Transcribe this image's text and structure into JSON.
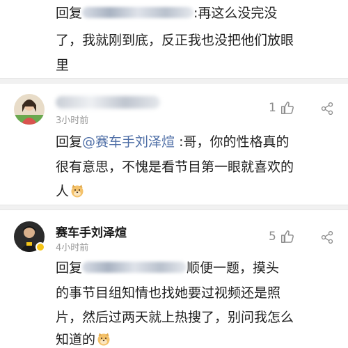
{
  "comment1": {
    "reply_prefix": "回复",
    "reply_text": ":再这么没完没",
    "line2": "了，我就刚到底，反正我也没把他们放眼",
    "line3": "里"
  },
  "comment2": {
    "time": "3小时前",
    "likes": "1",
    "reply_prefix": "回复",
    "mention": "@赛车手刘泽煊",
    "reply_text": " :哥，你的性格真的",
    "line2": "很有意思，不愧是看节目第一眼就喜欢的",
    "line3": "人",
    "emoji": "doge-emoji"
  },
  "comment3": {
    "username": "赛车手刘泽煊",
    "time": "4小时前",
    "likes": "5",
    "reply_prefix": "回复",
    "reply_text": "顺便一题，摸头",
    "line2": "的事节目组知情也找她要过视频还是照",
    "line3": "片，然后过两天就上热搜了，别问我怎么",
    "line4": "知道的",
    "emoji": "doge-emoji"
  },
  "icons": {
    "like": "thumbs-up-icon",
    "share": "share-icon"
  }
}
